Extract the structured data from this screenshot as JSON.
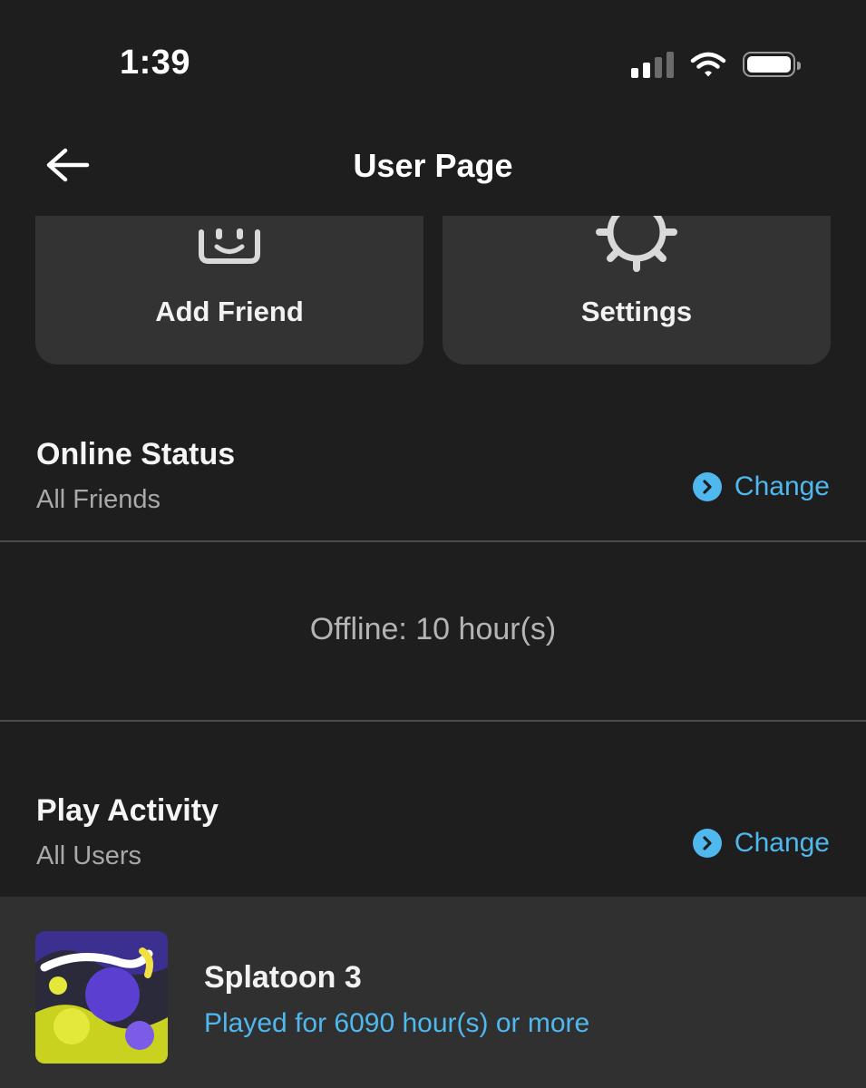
{
  "status_bar": {
    "time": "1:39"
  },
  "nav": {
    "title": "User Page"
  },
  "actions": {
    "add_friend": "Add Friend",
    "settings": "Settings"
  },
  "online_status": {
    "title": "Online Status",
    "value": "All Friends",
    "change_label": "Change",
    "offline_text": "Offline: 10 hour(s)"
  },
  "play_activity": {
    "title": "Play Activity",
    "value": "All Users",
    "change_label": "Change",
    "games": [
      {
        "name": "Splatoon 3",
        "play_time": "Played for 6090 hour(s) or more"
      }
    ]
  },
  "colors": {
    "background": "#1e1e1e",
    "card": "#333333",
    "accent": "#4fb8ee"
  },
  "icons": [
    "back-arrow-icon",
    "add-friend-icon",
    "gear-icon",
    "chevron-right-icon",
    "signal-icon",
    "wifi-icon",
    "battery-icon"
  ]
}
